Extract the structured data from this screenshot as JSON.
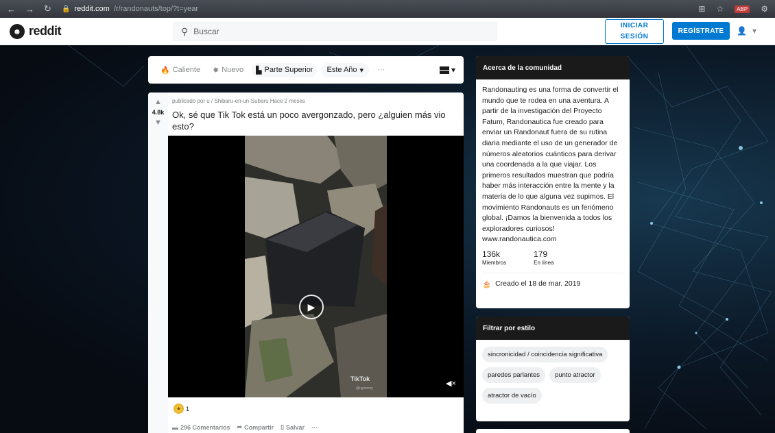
{
  "browser": {
    "url_domain": "reddit.com",
    "url_path": "/r/randonauts/top/?t=year",
    "ext_badge": "ABP"
  },
  "header": {
    "logo_text": "reddit",
    "search_placeholder": "Buscar",
    "login_line1": "INICIAR",
    "login_line2": "SESIÓN",
    "signup_label": "REGÍSTRATE"
  },
  "sortbar": {
    "hot": "Caliente",
    "new": "Nuevo",
    "top": "Parte Superior",
    "period": "Este Año",
    "more": "···"
  },
  "post": {
    "votes": "4.8k",
    "meta": "publicado por u / Shibaru-en-un-Subaru Hace 2 meses",
    "title": "Ok, sé que Tik Tok está un poco avergonzado, pero ¿alguien más vio esto?",
    "tiktok_label": "TikTok",
    "tiktok_user": "@ugnwezy",
    "award_count": "1",
    "comments": "296 Comentarios",
    "share": "Compartir",
    "save": "Salvar",
    "more": "···"
  },
  "about": {
    "heading": "Acerca de la comunidad",
    "description": "Randonauting es una forma de convertir el mundo que te rodea en una aventura. A partir de la investigación del Proyecto Fatum, Randonautica fue creado para enviar un Randonaut fuera de su rutina diaria mediante el uso de un generador de números aleatorios cuánticos para derivar una coordenada a la que viajar. Los primeros resultados muestran que podría haber más interacción entre la mente y la materia de lo que alguna vez supimos. El movimiento Randonauts es un fenómeno global. ¡Damos la bienvenida a todos los exploradores curiosos! www.randonautica.com",
    "members_value": "136k",
    "members_label": "Miembros",
    "online_value": "179",
    "online_label": "En línea",
    "created": "Creado el 18 de mar. 2019"
  },
  "filter": {
    "heading": "Filtrar por estilo",
    "chips": [
      "sincronicidad / coincidencia significativa",
      "paredes parlantes",
      "punto atractor",
      "atractor de vacío"
    ]
  }
}
